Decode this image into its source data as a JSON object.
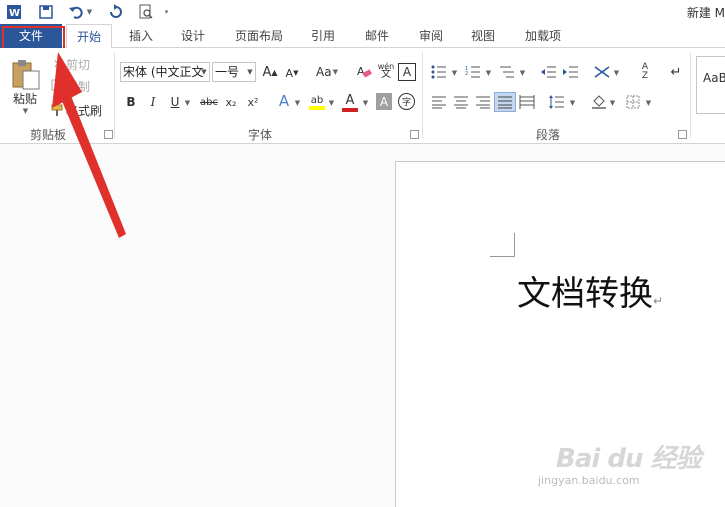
{
  "window": {
    "title": "新建 M"
  },
  "quick_access": {
    "icons": [
      "word-icon",
      "save-icon",
      "undo-icon",
      "redo-icon",
      "print-preview-icon",
      "customize-icon"
    ]
  },
  "tabs": [
    {
      "label": "文件"
    },
    {
      "label": "开始"
    },
    {
      "label": "插入"
    },
    {
      "label": "设计"
    },
    {
      "label": "页面布局"
    },
    {
      "label": "引用"
    },
    {
      "label": "邮件"
    },
    {
      "label": "审阅"
    },
    {
      "label": "视图"
    },
    {
      "label": "加载项"
    }
  ],
  "clipboard": {
    "paste": "粘贴",
    "cut": "剪切",
    "copy": "复制",
    "format_painter": "格式刷",
    "group_label": "剪贴板"
  },
  "font": {
    "name": "宋体 (中文正文",
    "size": "一号",
    "grow": "A",
    "shrink": "A",
    "case": "Aa",
    "phonetic": "wén",
    "bold": "B",
    "italic": "I",
    "underline": "U",
    "strike": "abc",
    "subscript": "x₂",
    "superscript": "x²",
    "text_effect": "A",
    "highlight": "ab",
    "font_color": "A",
    "shade": "A",
    "enclose": "字",
    "group_label": "字体"
  },
  "paragraph": {
    "group_label": "段落"
  },
  "styles": {
    "preview": "AaB"
  },
  "document": {
    "text": "文档转换",
    "para_mark": "↵"
  },
  "watermark": {
    "brand": "Bai du 经验",
    "site": "jingyan.baidu.com"
  },
  "colors": {
    "accent": "#2b579a",
    "highlight_bar": "#ffff00",
    "font_color_bar": "#d02020",
    "annotation_red": "#e0302c"
  }
}
